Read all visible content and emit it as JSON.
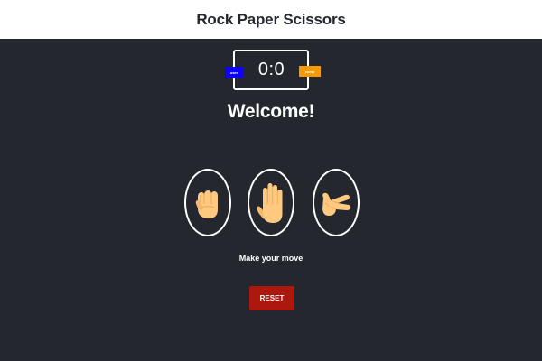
{
  "app": {
    "title": "Rock Paper Scissors"
  },
  "scoreboard": {
    "user_label": "user",
    "comp_label": "comp",
    "user_score": "0",
    "separator": ":",
    "comp_score": "0"
  },
  "result": {
    "message": "Welcome!"
  },
  "choices": [
    {
      "id": "rock",
      "icon": "rock-hand-icon"
    },
    {
      "id": "paper",
      "icon": "paper-hand-icon"
    },
    {
      "id": "scissors",
      "icon": "scissors-hand-icon"
    }
  ],
  "action": {
    "prompt": "Make your move"
  },
  "controls": {
    "reset_label": "RESET"
  },
  "colors": {
    "background": "#24272e",
    "header": "#ffffff",
    "user_badge": "#0c00ff",
    "comp_badge": "#f59b00",
    "reset_button": "#ad180e",
    "hand_skin": "#ffc97f"
  }
}
